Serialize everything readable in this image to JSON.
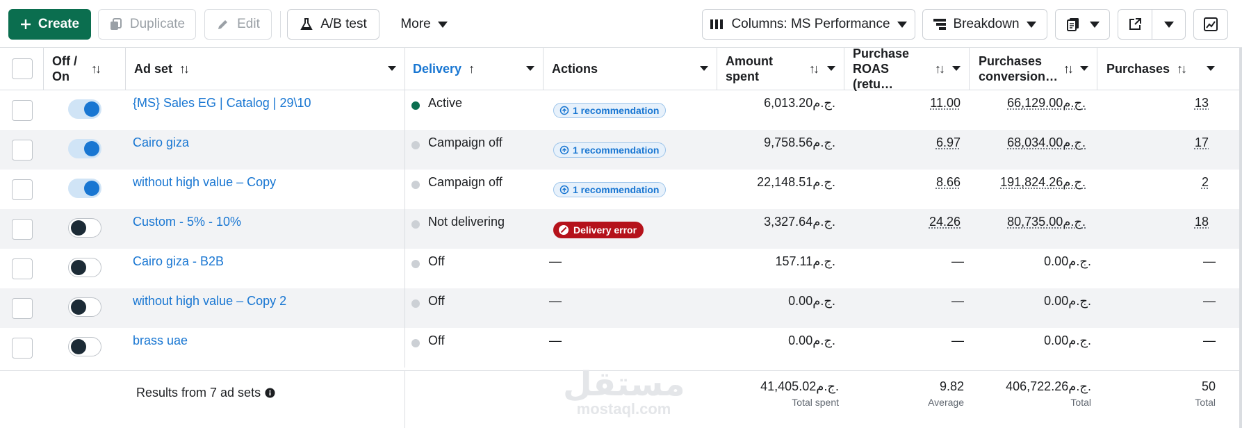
{
  "toolbar": {
    "create": "Create",
    "duplicate": "Duplicate",
    "edit": "Edit",
    "ab_test": "A/B test",
    "more": "More",
    "columns": "Columns: MS Performance",
    "breakdown": "Breakdown"
  },
  "headers": {
    "off_on": "Off / On",
    "ad_set": "Ad set",
    "delivery": "Delivery",
    "actions": "Actions",
    "amount_spent": "Amount spent",
    "purchase_roas": "Purchase ROAS (retu…",
    "purchases_conversion": "Purchases conversion…",
    "purchases": "Purchases"
  },
  "rows": [
    {
      "toggle_on": true,
      "name": "{MS} Sales EG | Catalog | 29\\10",
      "status": "Active",
      "status_active": true,
      "action_type": "recommendation",
      "action": "1 recommendation",
      "amount": "6,013.20ج.م.",
      "roas": "11.00",
      "conv": "66,129.00ج.م.",
      "purchases": "13"
    },
    {
      "toggle_on": true,
      "name": "Cairo giza",
      "status": "Campaign off",
      "status_active": false,
      "action_type": "recommendation",
      "action": "1 recommendation",
      "amount": "9,758.56ج.م.",
      "roas": "6.97",
      "conv": "68,034.00ج.م.",
      "purchases": "17"
    },
    {
      "toggle_on": true,
      "name": "without high value – Copy",
      "status": "Campaign off",
      "status_active": false,
      "action_type": "recommendation",
      "action": "1 recommendation",
      "amount": "22,148.51ج.م.",
      "roas": "8.66",
      "conv": "191,824.26ج.م.",
      "purchases": "2"
    },
    {
      "toggle_on": false,
      "name": "Custom - 5% - 10%",
      "status": "Not delivering",
      "status_active": false,
      "action_type": "error",
      "action": "Delivery error",
      "amount": "3,327.64ج.م.",
      "roas": "24.26",
      "conv": "80,735.00ج.م.",
      "purchases": "18"
    },
    {
      "toggle_on": false,
      "name": "Cairo giza - B2B",
      "status": "Off",
      "status_active": false,
      "action_type": "none",
      "action": "—",
      "amount": "157.11ج.م.",
      "roas": "—",
      "conv": "0.00ج.م.",
      "purchases": "—"
    },
    {
      "toggle_on": false,
      "name": "without high value – Copy 2",
      "status": "Off",
      "status_active": false,
      "action_type": "none",
      "action": "—",
      "amount": "0.00ج.م.",
      "roas": "—",
      "conv": "0.00ج.م.",
      "purchases": "—"
    },
    {
      "toggle_on": false,
      "name": "brass uae",
      "status": "Off",
      "status_active": false,
      "action_type": "none",
      "action": "—",
      "amount": "0.00ج.م.",
      "roas": "—",
      "conv": "0.00ج.م.",
      "purchases": "—"
    }
  ],
  "footer": {
    "results": "Results from 7 ad sets",
    "total_spent": "41,405.02ج.م.",
    "total_spent_label": "Total spent",
    "roas_avg": "9.82",
    "roas_avg_label": "Average",
    "conv_total": "406,722.26ج.م.",
    "conv_total_label": "Total",
    "purchases_total": "50",
    "purchases_total_label": "Total"
  },
  "watermark": {
    "arabic": "مستقل",
    "latin": "mostaql.com"
  },
  "colors": {
    "accent": "#1876d2",
    "create": "#0b6e4f",
    "error": "#b5121b",
    "active": "#0b6e4f"
  }
}
